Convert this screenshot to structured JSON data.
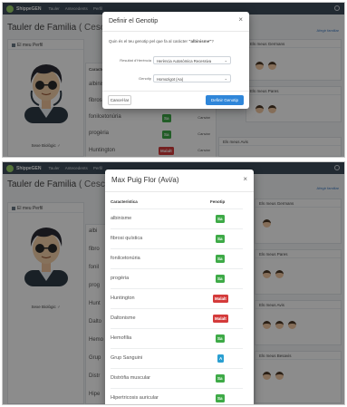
{
  "app": {
    "brand": "ShippeGEN",
    "nav": [
      "Tauler",
      "Antecedents",
      "Perfil"
    ]
  },
  "top_screen": {
    "title": "Tauler de Familia",
    "title_suffix": "( Cesc Puig",
    "link_right": "Afegir familiar",
    "profile_panel_title": "El meu Perfil",
    "avatar_label": "Sexe Biològic",
    "avatar_sex_symbol": "♂",
    "table_rows": [
      {
        "label": "Característica"
      },
      {
        "label": "albinisme"
      },
      {
        "label": "fibrosi quística"
      },
      {
        "label": "fonilcetonúria",
        "badge": "Sa",
        "badge_color": "#3eaa47",
        "action": "Canviar"
      },
      {
        "label": "progèria",
        "badge": "Sa",
        "badge_color": "#3eaa47",
        "action": "Canviar"
      },
      {
        "label": "Huntington",
        "badge": "Malalt",
        "badge_color": "#d43b3b",
        "action": "Canviar"
      }
    ],
    "right_panels": [
      "Els meus Germans",
      "Els meus Pares",
      "Els meus Avis"
    ],
    "modal": {
      "title": "Definir el Genotip",
      "question_prefix": "Quin és el teu genotip pel que fa al caràcter",
      "question_trait": "\"albinisme\"",
      "question_suffix": "?",
      "field1_label": "Resultat d'Herència",
      "field1_value": "Herència Autosòmica Recessiva",
      "field2_label": "Genotip",
      "field2_value": "Homozigot (Aa)",
      "cancel_label": "Cancel·lar",
      "confirm_label": "Definir Genotip"
    }
  },
  "bottom_screen": {
    "title": "Tauler de Familia",
    "title_suffix": "( Cesc Puig",
    "link_right": "Afegir familiar",
    "profile_panel_title": "El meu Perfil",
    "avatar_label": "Sexe Biològic",
    "avatar_sex_symbol": "♂",
    "left_rows": [
      "albi",
      "fibro",
      "fonil",
      "prog",
      "Hunt",
      "Dalto",
      "Hemo",
      "Grup",
      "Distr",
      "Hipe"
    ],
    "right_panels": [
      "Els meus Germans",
      "Els meus Pares",
      "Els meus Avis",
      "Els meus Besavis"
    ],
    "modal": {
      "title": "Max Puig Flor (Avi/a)",
      "col_trait": "Característica",
      "col_genotype": "Fenotip",
      "rows": [
        {
          "trait": "albinisme",
          "badge": "Sa",
          "color": "#3eaa47"
        },
        {
          "trait": "fibrosi quística",
          "badge": "Sa",
          "color": "#3eaa47"
        },
        {
          "trait": "fonilcetonúria",
          "badge": "Sa",
          "color": "#3eaa47"
        },
        {
          "trait": "progèria",
          "badge": "Sa",
          "color": "#3eaa47"
        },
        {
          "trait": "Huntington",
          "badge": "Malalt",
          "color": "#d43b3b"
        },
        {
          "trait": "Daltonisme",
          "badge": "Malalt",
          "color": "#d43b3b"
        },
        {
          "trait": "Hemofília",
          "badge": "Sa",
          "color": "#3eaa47"
        },
        {
          "trait": "Grup Sanguini",
          "badge": "A",
          "color": "#2a9fd1"
        },
        {
          "trait": "Distròfia muscular",
          "badge": "Sa",
          "color": "#3eaa47"
        },
        {
          "trait": "Hipertricosis auricular",
          "badge": "Sa",
          "color": "#3eaa47"
        }
      ]
    }
  }
}
